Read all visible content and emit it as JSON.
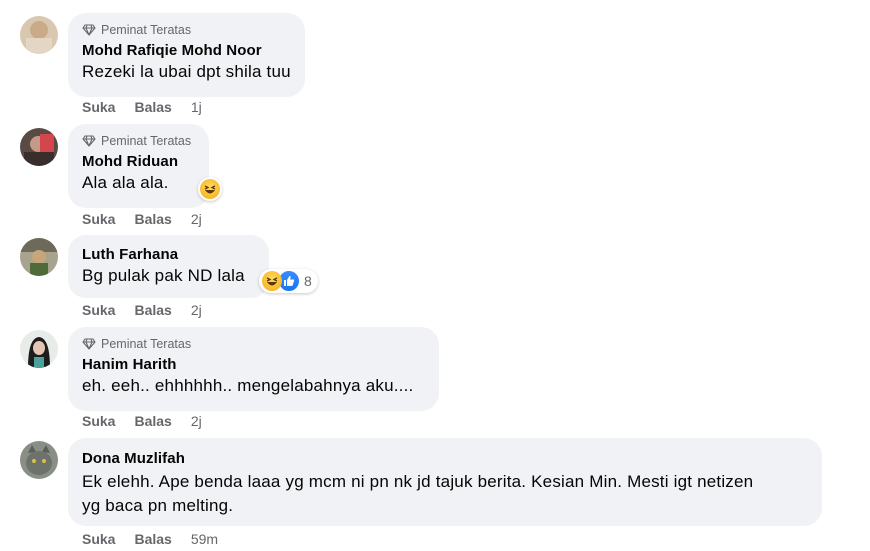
{
  "comments": [
    {
      "top_fan": true,
      "badge": "Peminat Teratas",
      "author": "Mohd Rafiqie Mohd Noor",
      "text": "Rezeki la ubai dpt shila tuu",
      "like": "Suka",
      "reply": "Balas",
      "time": "1j"
    },
    {
      "top_fan": true,
      "badge": "Peminat Teratas",
      "author": "Mohd Riduan",
      "text": "Ala ala ala.",
      "like": "Suka",
      "reply": "Balas",
      "time": "2j",
      "reactions": [
        "haha"
      ]
    },
    {
      "top_fan": false,
      "author": "Luth Farhana",
      "text": "Bg pulak pak ND lala",
      "like": "Suka",
      "reply": "Balas",
      "time": "2j",
      "reactions": [
        "haha",
        "like"
      ],
      "reaction_count": "8"
    },
    {
      "top_fan": true,
      "badge": "Peminat Teratas",
      "author": "Hanim Harith",
      "text": "eh. eeh.. ehhhhhh.. mengelabahnya aku....",
      "like": "Suka",
      "reply": "Balas",
      "time": "2j"
    },
    {
      "top_fan": false,
      "author": "Dona Muzlifah",
      "text_line1": "Ek elehh. Ape benda laaa yg mcm ni pn nk jd tajuk berita. Kesian Min. Mesti igt netizen",
      "text_line2": "yg baca pn melting.",
      "like": "Suka",
      "reply": "Balas",
      "time": "59m"
    }
  ],
  "colors": {
    "bubble": "#f0f2f5",
    "secondary_text": "#65676b",
    "like_blue": "#1877f2",
    "haha_yellow": "#f7b928"
  },
  "icons": [
    "diamond-icon",
    "haha-reaction-icon",
    "like-reaction-icon"
  ]
}
